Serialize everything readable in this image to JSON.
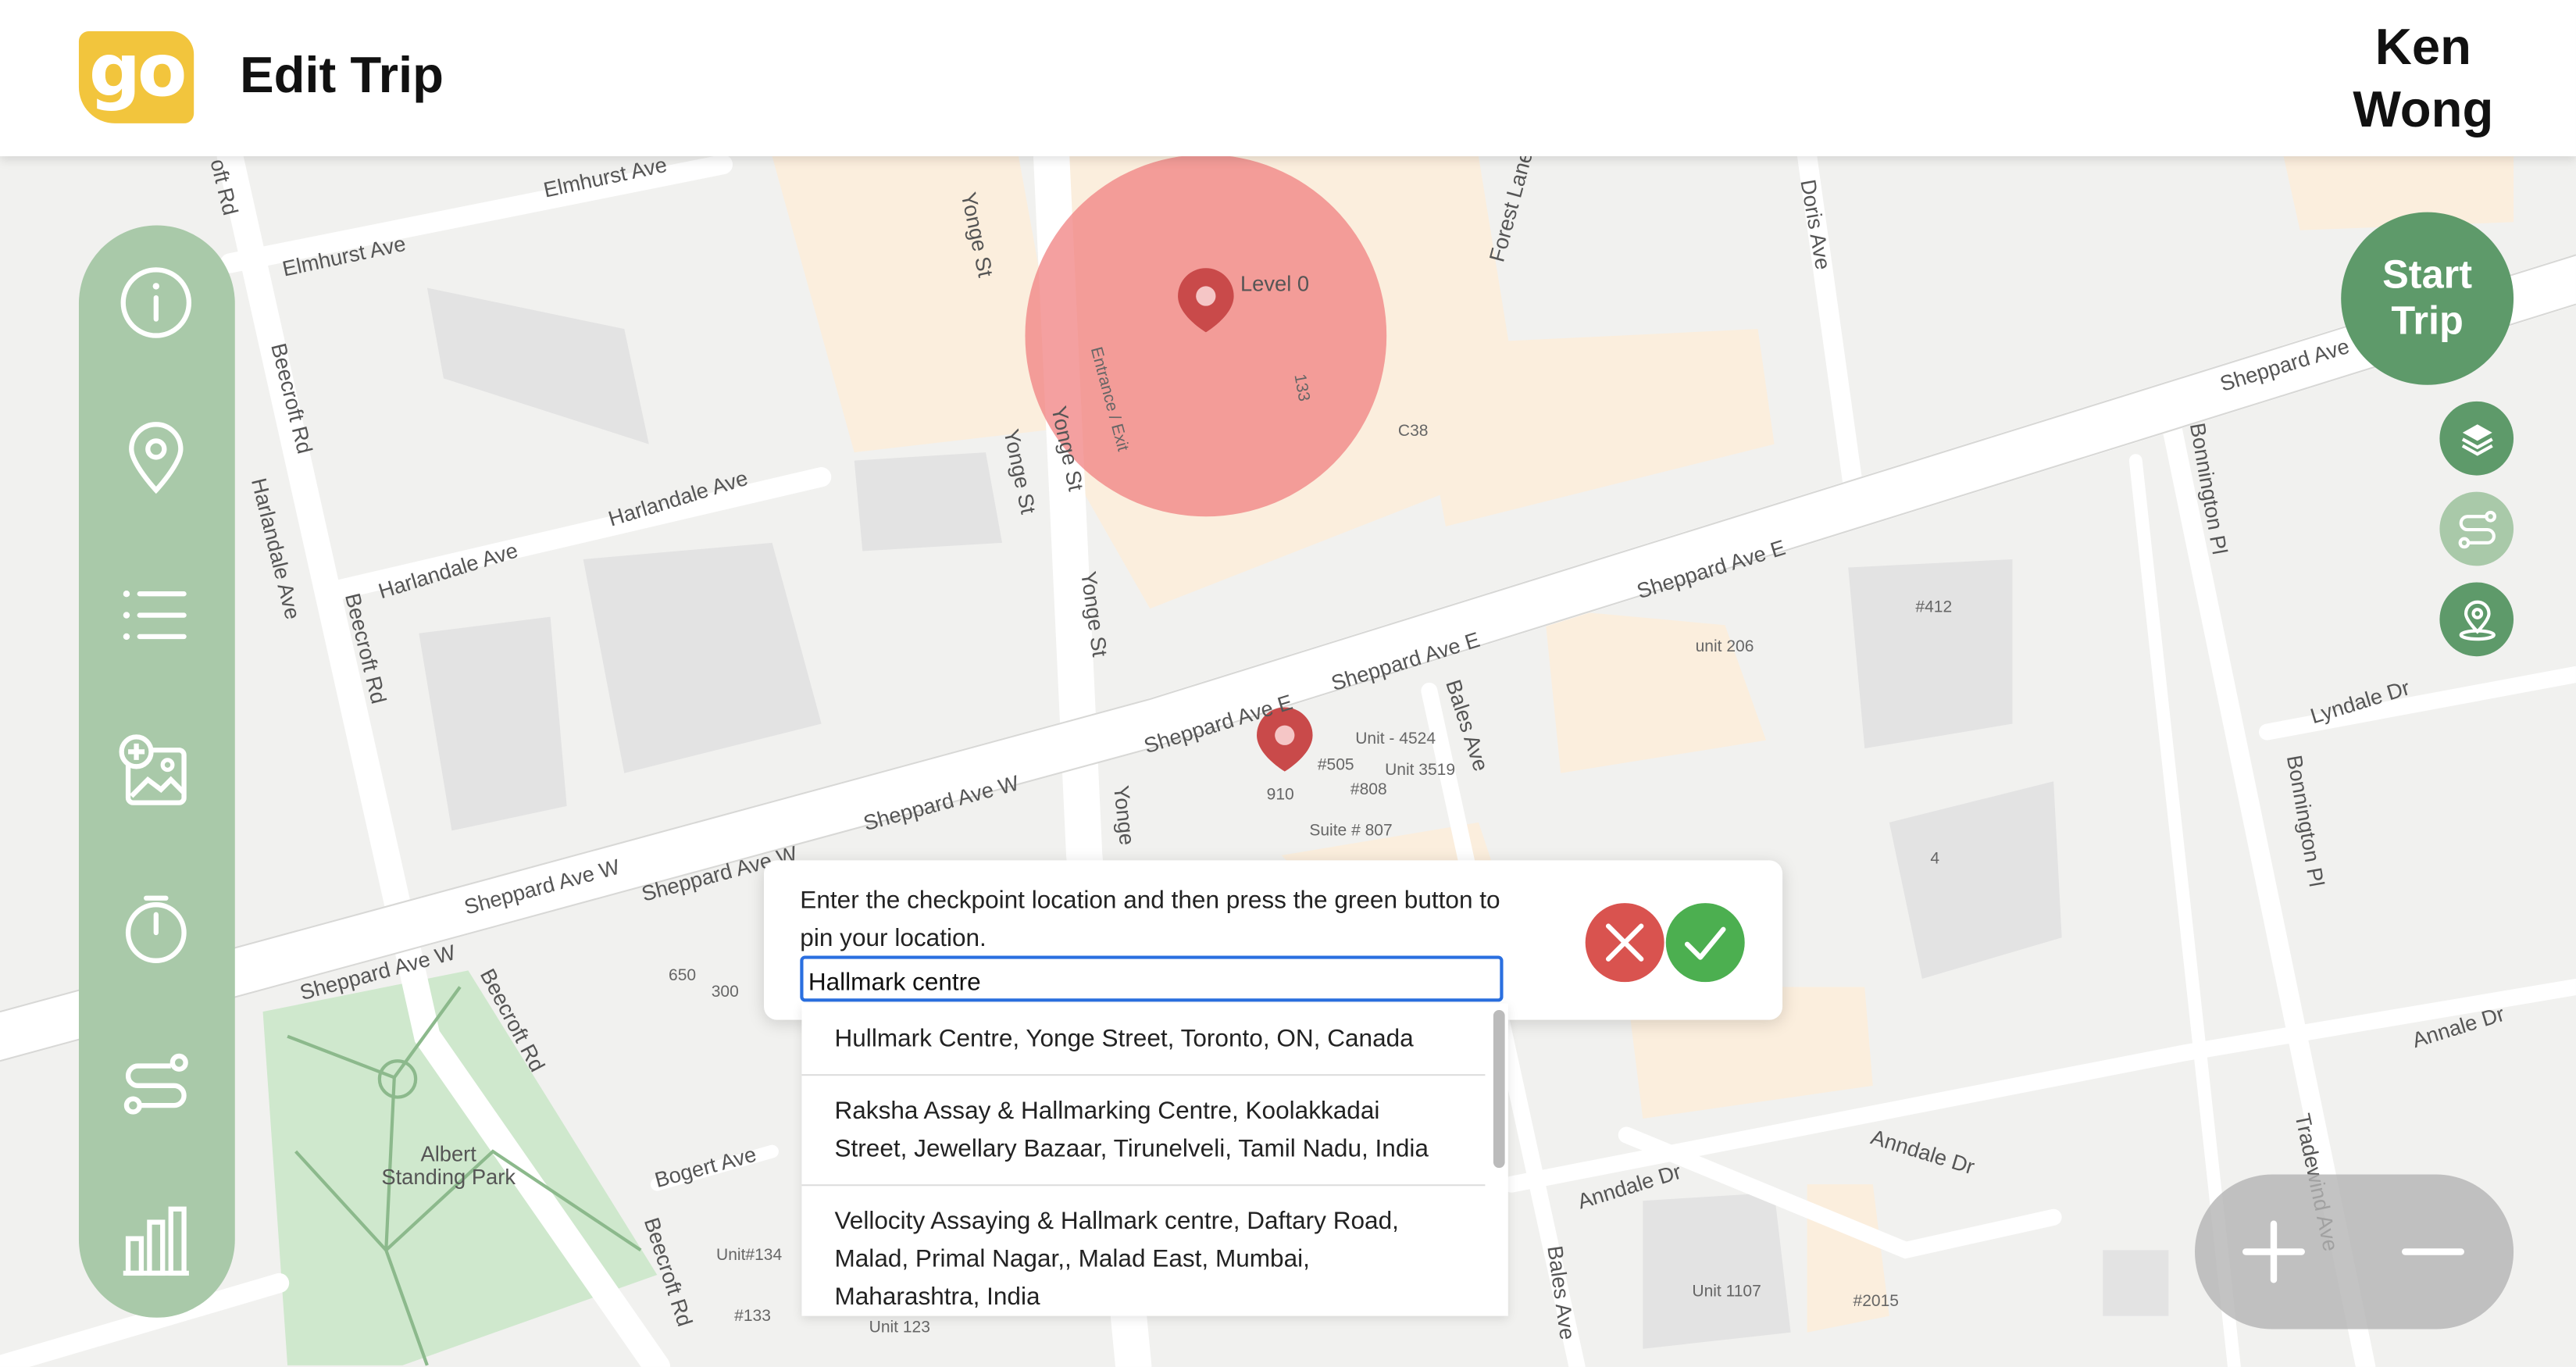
{
  "header": {
    "logo_text": "go",
    "title": "Edit Trip",
    "user_first": "Ken",
    "user_last": "Wong"
  },
  "sidebar": {
    "items": [
      {
        "icon": "info-icon"
      },
      {
        "icon": "location-pin-icon"
      },
      {
        "icon": "list-icon"
      },
      {
        "icon": "add-image-icon"
      },
      {
        "icon": "timer-icon"
      },
      {
        "icon": "route-icon"
      },
      {
        "icon": "bar-chart-icon"
      }
    ]
  },
  "controls": {
    "start_trip_line1": "Start",
    "start_trip_line2": "Trip",
    "layers_icon": "layers-icon",
    "route_icon": "route-icon",
    "person_pin_icon": "person-pin-icon",
    "zoom_in_icon": "plus-icon",
    "zoom_out_icon": "minus-icon"
  },
  "dialog": {
    "prompt": "Enter the checkpoint location and then press the green button to pin your location.",
    "input_value": "Hallmark centre",
    "cancel_icon": "close-icon",
    "confirm_icon": "check-icon"
  },
  "suggestions": [
    "Hullmark Centre, Yonge Street, Toronto, ON, Canada",
    "Raksha Assay & Hallmarking Centre, Koolakkadai Street, Jewellary Bazaar, Tirunelveli, Tamil Nadu, India",
    "Vellocity Assaying & Hallmark centre, Daftary Road, Malad, Primal Nagar,, Malad East, Mumbai, Maharashtra, India"
  ],
  "map": {
    "marker_label": "Level 0",
    "streets": {
      "yonge1": "Yonge St",
      "yonge2": "Yonge St",
      "yonge3": "Yonge St",
      "yonge4": "Yonge",
      "sheppard_e1": "Sheppard Ave E",
      "sheppard_e2": "Sheppard Ave E",
      "sheppard_e3": "Sheppard Ave E",
      "sheppard_e4": "Sheppard Ave",
      "sheppard_w1": "Sheppard Ave W",
      "sheppard_w2": "Sheppard Ave W",
      "sheppard_w3": "Sheppard Ave W",
      "sheppard_w4": "Sheppard Ave W",
      "beecroft1": "Beecroft Rd",
      "beecroft2": "Beecroft Rd",
      "beecroft3": "Beecroft Rd",
      "beecroft4": "Beecroft Rd",
      "elmhurst1": "Elmhurst Ave",
      "elmhurst2": "Elmhurst Ave",
      "harlandale1": "Harlandale Ave",
      "harlandale2": "Harlandale Ave",
      "harlandale3": "Harlandale Ave",
      "doris": "Doris Ave",
      "forest": "Forest Lanew",
      "bales1": "Bales Ave",
      "bales2": "Bales Ave",
      "bonnington1": "Bonnington Pl",
      "bonnington2": "Bonnington Pl",
      "lyndale": "Lyndale Dr",
      "annale": "Annale Dr",
      "anndale1": "Anndale Dr",
      "anndale2": "Anndale Dr",
      "tradewind": "Tradewind Ave",
      "bogert": "Bogert Ave",
      "park": "Albert Standing Park",
      "oft": "oft Rd"
    },
    "pois": {
      "entrance": "Entrance / Exit",
      "n133": "133",
      "c38": "C38",
      "n412": "#412",
      "unit206": "unit 206",
      "unit4524": "Unit - 4524",
      "n505": "#505",
      "unit3519": "Unit 3519",
      "n808": "#808",
      "n910": "910",
      "suite807": "Suite # 807",
      "n650": "650",
      "n300": "300",
      "n4": "4",
      "unit134": "Unit#134",
      "n133b": "#133",
      "unit123": "Unit 123",
      "unit1107": "Unit 1107",
      "n2015": "#2015"
    }
  },
  "colors": {
    "header_bg": "#ffffff",
    "sidebar_bg": "#a9c9a9",
    "start_trip_bg": "#5e9a6a",
    "cancel_bg": "#d9534f",
    "confirm_bg": "#4caf50",
    "logo_bg": "#f2c53d",
    "marker": "#c94a4a",
    "circle": "#f08080"
  }
}
